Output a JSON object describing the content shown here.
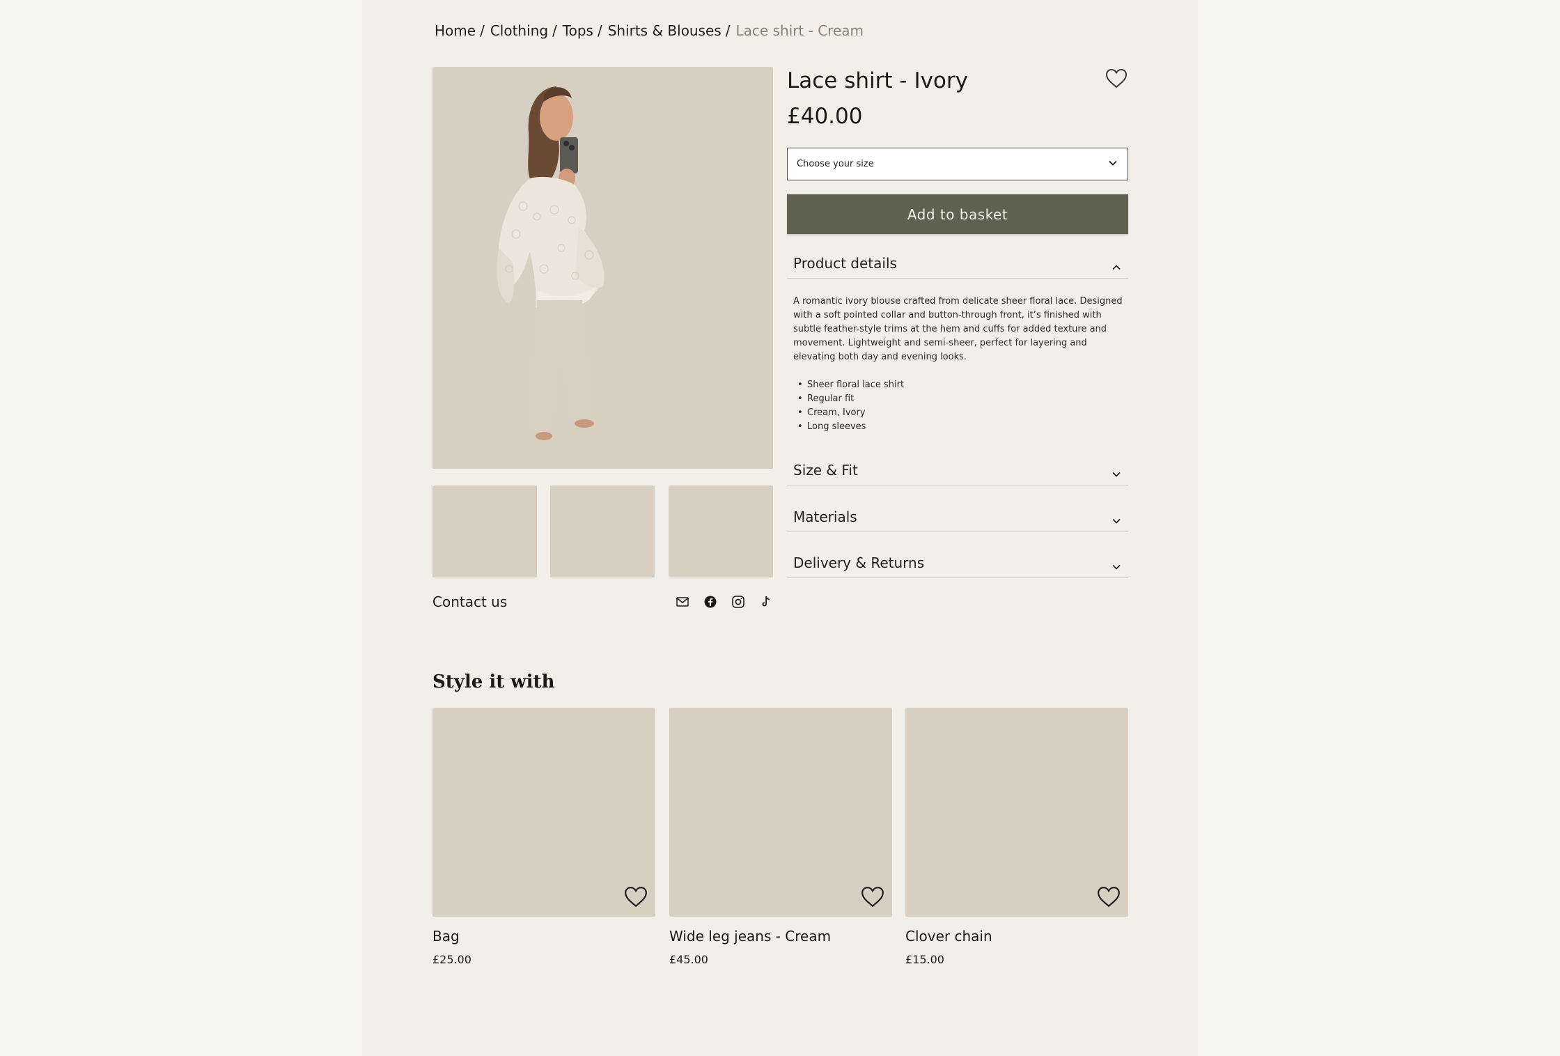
{
  "breadcrumb": {
    "items": [
      "Home",
      "Clothing",
      "Tops",
      "Shirts & Blouses"
    ],
    "separator": "/",
    "current": "Lace shirt - Cream"
  },
  "product": {
    "title": "Lace shirt - Ivory",
    "price": "£40.00",
    "size_placeholder": "Choose your size",
    "add_to_basket": "Add to basket",
    "wishlist_icon": "heart-icon"
  },
  "accordion": {
    "details_label": "Product details",
    "description": "A romantic ivory blouse crafted from delicate sheer floral lace. Designed with a soft pointed collar and button-through front, it’s finished with subtle feather-style trims at the hem and cuffs for added texture and movement. Lightweight and semi-sheer, perfect for layering and elevating both day and evening looks.",
    "bullets": [
      "Sheer floral lace shirt",
      "Regular fit",
      "Cream, Ivory",
      "Long sleeves"
    ],
    "size_fit_label": "Size & Fit",
    "materials_label": "Materials",
    "delivery_label": "Delivery & Returns"
  },
  "contact": {
    "label": "Contact us",
    "icons": [
      "mail-icon",
      "facebook-icon",
      "instagram-icon",
      "tiktok-icon"
    ]
  },
  "style_it_with": {
    "heading": "Style it with",
    "items": [
      {
        "name": "Bag",
        "price": "£25.00"
      },
      {
        "name": "Wide leg jeans - Cream",
        "price": "£45.00"
      },
      {
        "name": "Clover chain",
        "price": "£15.00"
      }
    ]
  },
  "colors": {
    "page_bg": "#f2efe9",
    "placeholder_bg": "#d8cfc3",
    "button_bg": "#5f6150"
  }
}
